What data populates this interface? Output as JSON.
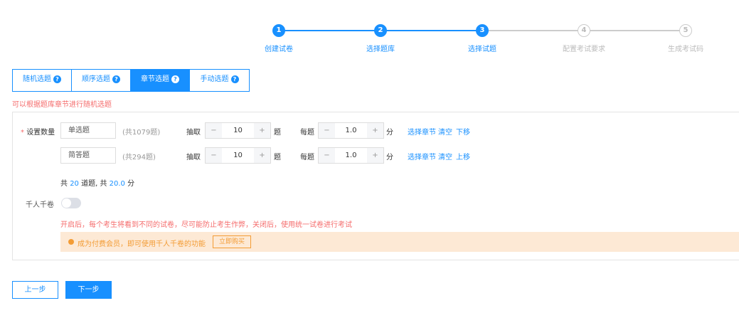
{
  "steps": [
    {
      "num": "1",
      "label": "创建试卷",
      "done": true
    },
    {
      "num": "2",
      "label": "选择题库",
      "done": true
    },
    {
      "num": "3",
      "label": "选择试题",
      "done": true
    },
    {
      "num": "4",
      "label": "配置考试要求",
      "done": false
    },
    {
      "num": "5",
      "label": "生成考试码",
      "done": false
    }
  ],
  "tabs": [
    {
      "label": "随机选题"
    },
    {
      "label": "顺序选题"
    },
    {
      "label": "章节选题",
      "active": true
    },
    {
      "label": "手动选题"
    }
  ],
  "help_icon": "?",
  "hint": "可以根据题库章节进行随机选题",
  "form": {
    "required_mark": "*",
    "count_label": "设置数量",
    "rows": [
      {
        "type": "单选题",
        "total": "(共1079题)",
        "extract_label": "抽取",
        "extract": "10",
        "unit": "题",
        "per_label": "每题",
        "score": "1.0",
        "score_unit": "分",
        "links": [
          "选择章节",
          "清空",
          "下移"
        ]
      },
      {
        "type": "简答题",
        "total": "(共294题)",
        "extract_label": "抽取",
        "extract": "10",
        "unit": "题",
        "per_label": "每题",
        "score": "1.0",
        "score_unit": "分",
        "links": [
          "选择章节",
          "清空",
          "上移"
        ]
      }
    ],
    "summary": {
      "p1": "共",
      "count": "20",
      "p2": "道题, 共",
      "score": "20.0",
      "p3": "分"
    },
    "minus": "−",
    "plus": "+",
    "toggle_label": "千人千卷",
    "toggle_on": false,
    "toggle_desc": "开启后，每个考生将看到不同的试卷，尽可能防止考生作弊，关闭后，使用统一试卷进行考试",
    "banner": {
      "text": "成为付费会员，即可使用千人千卷的功能",
      "button": "立即购买"
    }
  },
  "footer": {
    "prev": "上一步",
    "next": "下一步"
  },
  "colors": {
    "primary": "#1890ff",
    "warning": "#f56c6c",
    "banner_bg": "#fde9d5",
    "banner_accent": "#f39c35"
  }
}
